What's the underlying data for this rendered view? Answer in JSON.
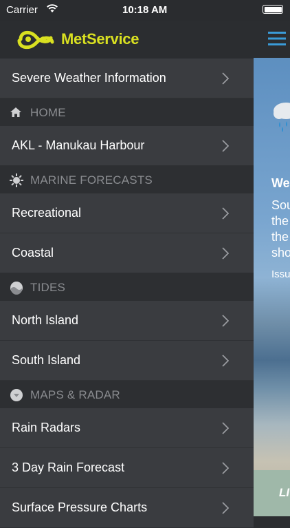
{
  "status_bar": {
    "carrier": "Carrier",
    "time": "10:18 AM"
  },
  "brand": {
    "name": "MetService",
    "accent_color": "#d9e021"
  },
  "menu": {
    "severe_weather": "Severe Weather Information",
    "home": {
      "header": "HOME",
      "icon": "home-icon",
      "items": [
        "AKL - Manukau Harbour"
      ]
    },
    "marine": {
      "header": "MARINE FORECASTS",
      "icon": "sun-gear-icon",
      "items": [
        "Recreational",
        "Coastal"
      ]
    },
    "tides": {
      "header": "TIDES",
      "icon": "tide-icon",
      "items": [
        "North Island",
        "South Island"
      ]
    },
    "maps": {
      "header": "MAPS & RADAR",
      "icon": "radar-icon",
      "items": [
        "Rain Radars",
        "3 Day Rain Forecast",
        "Surface Pressure Charts"
      ]
    }
  },
  "content_peek": {
    "title": "We",
    "body_lines": [
      "Sou",
      "the",
      "the",
      "sho"
    ],
    "issued": "Issu",
    "footer": "LI"
  }
}
